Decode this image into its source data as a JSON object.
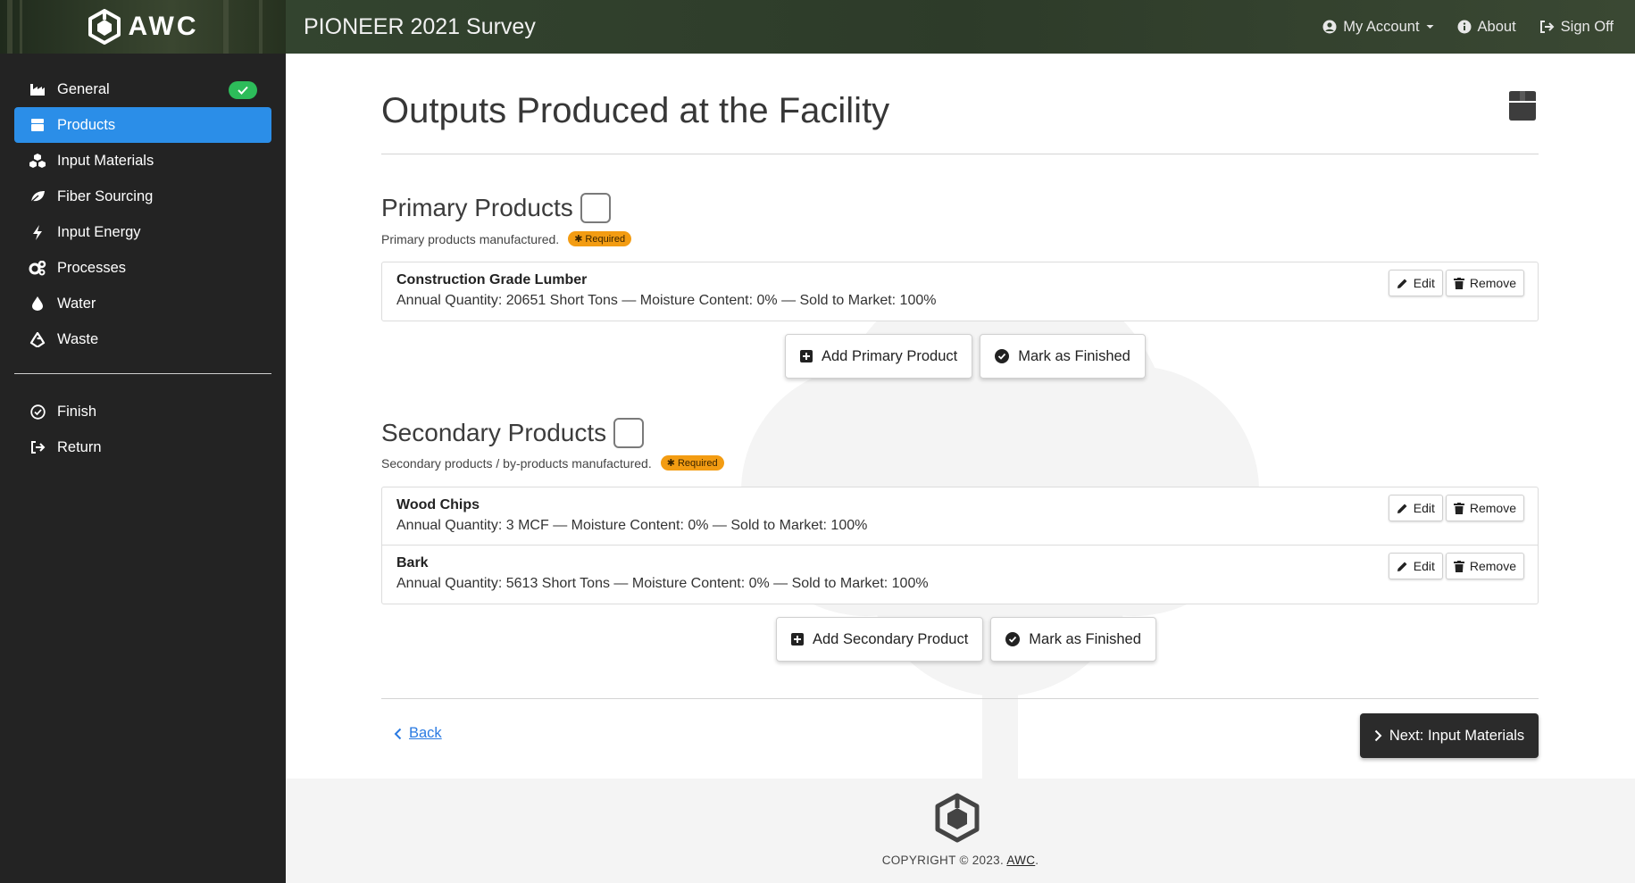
{
  "brand": {
    "name": "AWC"
  },
  "header": {
    "title": "PIONEER 2021 Survey",
    "links": [
      {
        "label": "My Account",
        "icon": "user-circle-icon"
      },
      {
        "label": "About",
        "icon": "info-circle-icon"
      },
      {
        "label": "Sign Off",
        "icon": "sign-out-icon"
      }
    ]
  },
  "sidebar": {
    "items": [
      {
        "label": "General",
        "icon": "industry-icon",
        "completed": true
      },
      {
        "label": "Products",
        "icon": "box-icon",
        "active": true
      },
      {
        "label": "Input Materials",
        "icon": "cubes-icon"
      },
      {
        "label": "Fiber Sourcing",
        "icon": "leaf-icon"
      },
      {
        "label": "Input Energy",
        "icon": "bolt-icon"
      },
      {
        "label": "Processes",
        "icon": "cogs-icon"
      },
      {
        "label": "Water",
        "icon": "droplet-icon"
      },
      {
        "label": "Waste",
        "icon": "recycle-icon"
      }
    ],
    "secondary": [
      {
        "label": "Finish",
        "icon": "check-circle-icon"
      },
      {
        "label": "Return",
        "icon": "sign-out-icon"
      }
    ]
  },
  "page": {
    "title": "Outputs Produced at the Facility",
    "title_icon": "box-icon"
  },
  "primary": {
    "title": "Primary Products",
    "description": "Primary products manufactured.",
    "required_label": "Required",
    "items": [
      {
        "name": "Construction Grade Lumber",
        "detail": "Annual Quantity: 20651 Short Tons — Moisture Content: 0% — Sold to Market: 100%"
      }
    ],
    "add_label": "Add Primary Product",
    "finish_label": "Mark as Finished"
  },
  "secondary": {
    "title": "Secondary Products",
    "description": "Secondary products / by-products manufactured.",
    "required_label": "Required",
    "items": [
      {
        "name": "Wood Chips",
        "detail": "Annual Quantity: 3 MCF — Moisture Content: 0% — Sold to Market: 100%"
      },
      {
        "name": "Bark",
        "detail": "Annual Quantity: 5613 Short Tons — Moisture Content: 0% — Sold to Market: 100%"
      }
    ],
    "add_label": "Add Secondary Product",
    "finish_label": "Mark as Finished"
  },
  "row_actions": {
    "edit": "Edit",
    "remove": "Remove"
  },
  "navigation": {
    "back": "Back",
    "next": "Next: Input Materials"
  },
  "footer": {
    "copyright": "COPYRIGHT © 2023.",
    "brand": "AWC",
    "suffix": "."
  },
  "colors": {
    "accent": "#2b8ee8",
    "success": "#2dbc5a",
    "required": "#f39c12",
    "sidebar": "#232323",
    "primary_button": "#2b2b2b"
  }
}
